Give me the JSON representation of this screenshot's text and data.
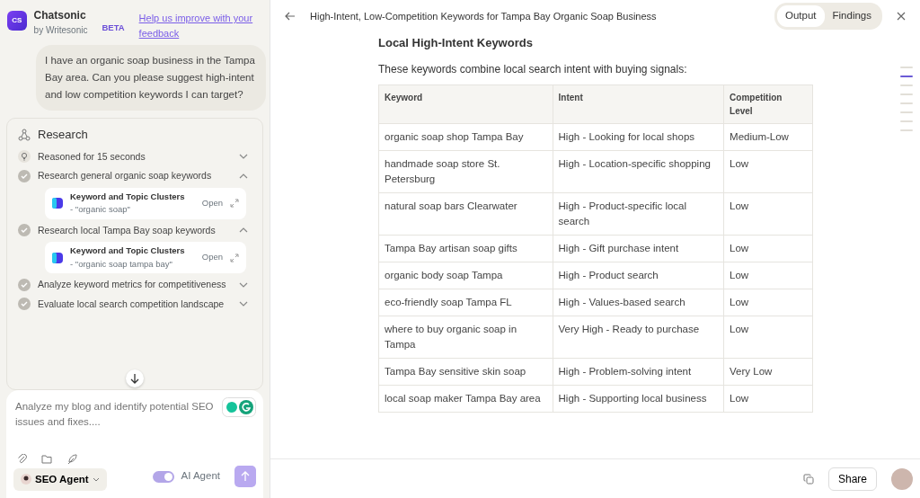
{
  "app": {
    "logo": "CS",
    "name": "Chatsonic",
    "byline": "by Writesonic",
    "badge": "BETA",
    "feedback_link": "Help us improve with your feedback"
  },
  "user_message": "I have an organic soap business in the Tampa Bay area. Can you please suggest high-intent and low competition keywords I can target?",
  "research": {
    "title": "Research",
    "steps": [
      {
        "kind": "reasoning",
        "label": "Reasoned for 15 seconds",
        "expanded": false
      },
      {
        "kind": "step",
        "label": "Research general organic soap keywords",
        "expanded": true,
        "tools": [
          {
            "name": "Keyword and Topic Clusters",
            "query": "- \"organic soap\"",
            "action": "Open"
          }
        ]
      },
      {
        "kind": "step",
        "label": "Research local Tampa Bay soap keywords",
        "expanded": true,
        "tools": [
          {
            "name": "Keyword and Topic Clusters",
            "query": "- \"organic soap tampa bay\"",
            "action": "Open"
          }
        ]
      },
      {
        "kind": "step",
        "label": "Analyze keyword metrics for competitiveness",
        "expanded": false
      },
      {
        "kind": "step",
        "label": "Evaluate local search competition landscape",
        "expanded": false
      }
    ]
  },
  "composer": {
    "placeholder": "Analyze my blog and identify potential SEO issues and fixes....",
    "agent": "SEO Agent",
    "toggle": {
      "label": "AI Agent",
      "on": true
    }
  },
  "document": {
    "title": "High-Intent, Low-Competition Keywords for Tampa Bay Organic Soap Business",
    "tabs": [
      {
        "label": "Output",
        "selected": true
      },
      {
        "label": "Findings",
        "selected": false
      }
    ],
    "heading": "Local High-Intent Keywords",
    "intro": "These keywords combine local search intent with buying signals:",
    "table": {
      "columns": [
        "Keyword",
        "Intent",
        "Competition Level"
      ],
      "rows": [
        [
          "organic soap shop Tampa Bay",
          "High - Looking for local shops",
          "Medium-Low"
        ],
        [
          "handmade soap store St. Petersburg",
          "High - Location-specific shopping",
          "Low"
        ],
        [
          "natural soap bars Clearwater",
          "High - Product-specific local search",
          "Low"
        ],
        [
          "Tampa Bay artisan soap gifts",
          "High - Gift purchase intent",
          "Low"
        ],
        [
          "organic body soap Tampa",
          "High - Product search",
          "Low"
        ],
        [
          "eco-friendly soap Tampa FL",
          "High - Values-based search",
          "Low"
        ],
        [
          "where to buy organic soap in Tampa",
          "Very High - Ready to purchase",
          "Low"
        ],
        [
          "Tampa Bay sensitive skin soap",
          "High - Problem-solving intent",
          "Very Low"
        ],
        [
          "local soap maker Tampa Bay area",
          "High - Supporting local business",
          "Low"
        ]
      ]
    },
    "outline": [
      {
        "selected": false
      },
      {
        "selected": true
      },
      {
        "selected": false
      },
      {
        "selected": false
      },
      {
        "selected": false
      },
      {
        "selected": false
      },
      {
        "selected": false
      },
      {
        "selected": false
      }
    ],
    "share": "Share"
  }
}
